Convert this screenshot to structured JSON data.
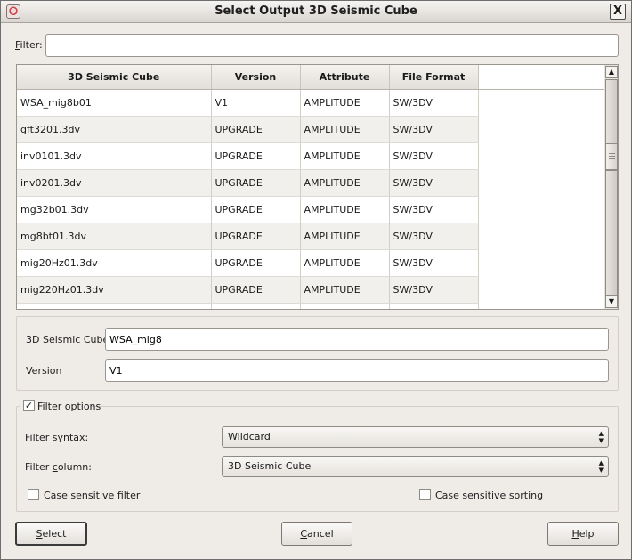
{
  "window": {
    "title": "Select Output 3D Seismic Cube",
    "close_label": "X"
  },
  "filter": {
    "label_prefix": "",
    "label_mnemonic": "F",
    "label_rest": "ilter:",
    "value": ""
  },
  "table": {
    "columns": [
      "3D Seismic Cube",
      "Version",
      "Attribute",
      "File Format"
    ],
    "rows": [
      [
        "WSA_mig8b01",
        "V1",
        "AMPLITUDE",
        "SW/3DV"
      ],
      [
        "gft3201.3dv",
        "UPGRADE",
        "AMPLITUDE",
        "SW/3DV"
      ],
      [
        "inv0101.3dv",
        "UPGRADE",
        "AMPLITUDE",
        "SW/3DV"
      ],
      [
        "inv0201.3dv",
        "UPGRADE",
        "AMPLITUDE",
        "SW/3DV"
      ],
      [
        "mg32b01.3dv",
        "UPGRADE",
        "AMPLITUDE",
        "SW/3DV"
      ],
      [
        "mg8bt01.3dv",
        "UPGRADE",
        "AMPLITUDE",
        "SW/3DV"
      ],
      [
        "mig20Hz01.3dv",
        "UPGRADE",
        "AMPLITUDE",
        "SW/3DV"
      ],
      [
        "mig220Hz01.3dv",
        "UPGRADE",
        "AMPLITUDE",
        "SW/3DV"
      ]
    ]
  },
  "selection": {
    "cube_label": "3D Seismic Cube",
    "cube_value": "WSA_mig8",
    "version_label": "Version",
    "version_value": "V1"
  },
  "filter_options": {
    "checked": true,
    "label": "Filter options",
    "syntax_label_a": "Filter ",
    "syntax_label_m": "s",
    "syntax_label_b": "yntax:",
    "syntax_value": "Wildcard",
    "column_label_a": "Filter ",
    "column_label_m": "c",
    "column_label_b": "olumn:",
    "column_value": "3D Seismic Cube",
    "case_filter_label": "Case sensitive filter",
    "case_sort_label": "Case sensitive sorting"
  },
  "buttons": {
    "select_m": "S",
    "select_rest": "elect",
    "cancel_m": "C",
    "cancel_rest": "ancel",
    "help_m": "H",
    "help_rest": "elp"
  },
  "icons": {
    "check": "✓",
    "scroll_up": "▲",
    "scroll_down": "▼",
    "updown": "▲▼"
  }
}
